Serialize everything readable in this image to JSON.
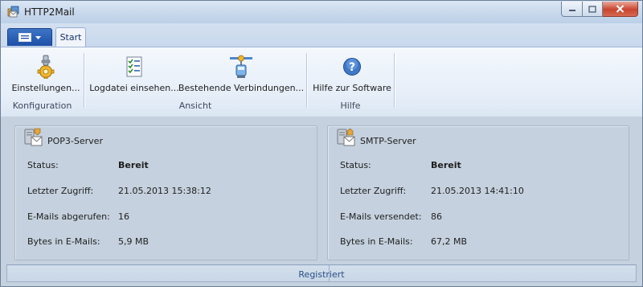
{
  "window": {
    "title": "HTTP2Mail"
  },
  "ribbon": {
    "tabs": [
      {
        "label": "Start",
        "selected": true
      }
    ],
    "groups": [
      {
        "label": "Konfiguration",
        "buttons": [
          {
            "label": "Einstellungen...",
            "icon": "settings-gear-icon"
          }
        ]
      },
      {
        "label": "Ansicht",
        "buttons": [
          {
            "label": "Logdatei einsehen...",
            "icon": "log-checklist-icon"
          },
          {
            "label": "Bestehende Verbindungen...",
            "icon": "network-connections-icon"
          }
        ]
      },
      {
        "label": "Hilfe",
        "buttons": [
          {
            "label": "Hilfe zur Software",
            "icon": "help-icon"
          }
        ]
      }
    ]
  },
  "pop3": {
    "title": "POP3-Server",
    "rows": [
      {
        "label": "Status:",
        "value": "Bereit"
      },
      {
        "label": "Letzter Zugriff:",
        "value": "21.05.2013 15:38:12"
      },
      {
        "label": "E-Mails abgerufen:",
        "value": "16"
      },
      {
        "label": "Bytes in E-Mails:",
        "value": "5,9 MB"
      }
    ]
  },
  "smtp": {
    "title": "SMTP-Server",
    "rows": [
      {
        "label": "Status:",
        "value": "Bereit"
      },
      {
        "label": "Letzter Zugriff:",
        "value": "21.05.2013 14:41:10"
      },
      {
        "label": "E-Mails versendet:",
        "value": "86"
      },
      {
        "label": "Bytes in E-Mails:",
        "value": "67,2 MB"
      }
    ]
  },
  "statusbar": {
    "text": "Registriert"
  },
  "colors": {
    "accent": "#1d4fa6",
    "status_text": "#2a4f86",
    "content_bg": "#c5d1de"
  }
}
